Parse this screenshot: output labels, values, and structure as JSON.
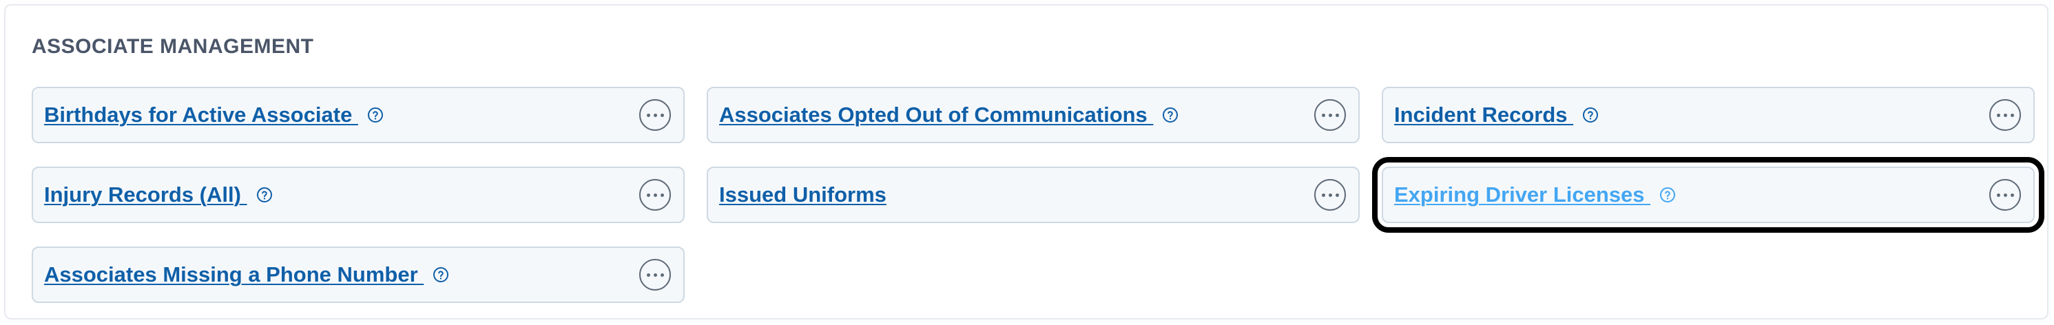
{
  "section": {
    "title": "ASSOCIATE MANAGEMENT"
  },
  "colors": {
    "link": "#0f5fa8",
    "link_selected": "#43a6f2",
    "card_bg": "#f5f8fb",
    "card_border": "#cfd9e3",
    "title": "#4a5568"
  },
  "reports": [
    {
      "label": "Birthdays for Active Associate ",
      "has_help": true,
      "icon_help": "question-circle-icon",
      "icon_menu": "ellipsis-icon"
    },
    {
      "label": "Associates Opted Out of Communications ",
      "has_help": true,
      "icon_help": "question-circle-icon",
      "icon_menu": "ellipsis-icon"
    },
    {
      "label": "Incident Records ",
      "has_help": true,
      "icon_help": "question-circle-icon",
      "icon_menu": "ellipsis-icon"
    },
    {
      "label": "Injury Records (All) ",
      "has_help": true,
      "icon_help": "question-circle-icon",
      "icon_menu": "ellipsis-icon"
    },
    {
      "label": "Issued Uniforms",
      "has_help": false,
      "icon_menu": "ellipsis-icon"
    },
    {
      "label": "Expiring Driver Licenses ",
      "has_help": true,
      "selected": true,
      "icon_help": "question-circle-icon",
      "icon_menu": "ellipsis-icon"
    },
    {
      "label": "Associates Missing a Phone Number ",
      "has_help": true,
      "icon_help": "question-circle-icon",
      "icon_menu": "ellipsis-icon"
    }
  ]
}
